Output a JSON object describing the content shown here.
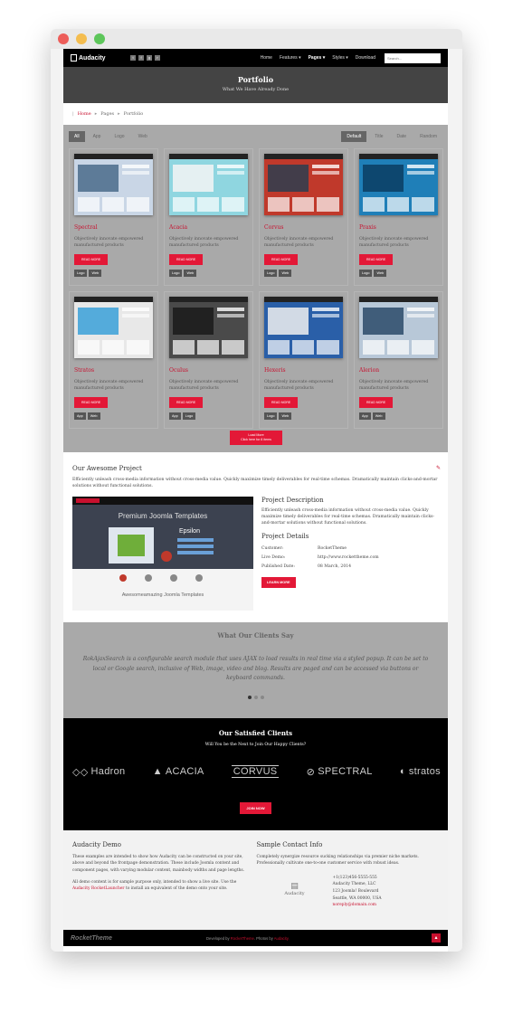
{
  "nav": {
    "logo": "Audacity",
    "social": [
      "t",
      "f",
      "g",
      "r"
    ],
    "menu": [
      "Home",
      "Features ▾",
      "Pages ▾",
      "Styles ▾",
      "Download"
    ],
    "search_placeholder": "Search..."
  },
  "hero": {
    "title": "Portfolio",
    "subtitle": "What We Have Already Done"
  },
  "breadcrumb": {
    "home": "Home",
    "pages": "Pages",
    "current": "Portfolio"
  },
  "filters": {
    "left": [
      "All",
      "App",
      "Logo",
      "Web"
    ],
    "right": [
      "Default",
      "Title",
      "Date",
      "Random"
    ]
  },
  "items": [
    {
      "title": "Spectral",
      "desc": "Objectively innovate empowered manufactured products",
      "btn": "READ MORE",
      "tags": [
        "Logo",
        "Web"
      ],
      "colors": [
        "#c9d6e6",
        "#4a6b8a"
      ]
    },
    {
      "title": "Acacia",
      "desc": "Objectively innovate empowered manufactured products",
      "btn": "READ MORE",
      "tags": [
        "Logo",
        "Web"
      ],
      "colors": [
        "#8fd6e0",
        "#f5f5f5"
      ]
    },
    {
      "title": "Corvus",
      "desc": "Objectively innovate empowered manufactured products",
      "btn": "READ MORE",
      "tags": [
        "Logo",
        "Web"
      ],
      "colors": [
        "#c0392b",
        "#2c3e50"
      ]
    },
    {
      "title": "Praxis",
      "desc": "Objectively innovate empowered manufactured products",
      "btn": "READ MORE",
      "tags": [
        "Logo",
        "Web"
      ],
      "colors": [
        "#1f7fb8",
        "#0b3d61"
      ]
    },
    {
      "title": "Stratos",
      "desc": "Objectively innovate empowered manufactured products",
      "btn": "READ MORE",
      "tags": [
        "App",
        "Web"
      ],
      "colors": [
        "#e8e8e8",
        "#3aa0d8"
      ]
    },
    {
      "title": "Oculus",
      "desc": "Objectively innovate empowered manufactured products",
      "btn": "READ MORE",
      "tags": [
        "App",
        "Logo"
      ],
      "colors": [
        "#4a4a4a",
        "#1a1a1a"
      ]
    },
    {
      "title": "Hexeris",
      "desc": "Objectively innovate empowered manufactured products",
      "btn": "READ MORE",
      "tags": [
        "Logo",
        "Web"
      ],
      "colors": [
        "#2a5fa8",
        "#f0f0f0"
      ]
    },
    {
      "title": "Alerion",
      "desc": "Objectively innovate empowered manufactured products",
      "btn": "READ MORE",
      "tags": [
        "App",
        "Web"
      ],
      "colors": [
        "#b8c8d8",
        "#2a4a6a"
      ]
    }
  ],
  "load_more": {
    "line1": "Load More",
    "line2": "Click here for 8 items"
  },
  "project": {
    "heading": "Our Awesome Project",
    "intro": "Efficiently unleash cross-media information without cross-media value. Quickly maximize timely deliverables for real-time schemas. Dramatically maintain clicks-and-mortar solutions without functional solutions.",
    "shot_title": "Premium Joomla Templates",
    "shot_sub": "Epsilon",
    "shot_caption": "Awesomeamazing Joomla Templates",
    "desc_heading": "Project Description",
    "desc": "Efficiently unleash cross-media information without cross-media value. Quickly maximize timely deliverables for real-time schemas. Dramatically maintain clicks-and-mortar solutions without functional solutions.",
    "details_heading": "Project Details",
    "details": [
      {
        "label": "Customer:",
        "value": "RocketTheme"
      },
      {
        "label": "Live Demo:",
        "value": "http://www.rockettheme.com"
      },
      {
        "label": "Published Date:",
        "value": "08 March, 2014"
      }
    ],
    "btn": "LEARN MORE"
  },
  "clients": {
    "heading": "What Our Clients Say",
    "quote": "RokAjaxSearch is a configurable search module that uses AJAX to load results in real time via a styled popup. It can be set to local or Google search, inclusive of Web, image, video and blog. Results are paged and can be accessed via buttons or keyboard commands."
  },
  "satisfied": {
    "heading": "Our Satisfied Clients",
    "sub": "Will You be the Next to Join Our Happy Clients?",
    "brands": [
      "Hadron",
      "ACACIA",
      "CORVUS",
      "SPECTRAL",
      "stratos"
    ],
    "btn": "JOIN NOW"
  },
  "footer": {
    "demo_heading": "Audacity Demo",
    "demo_p1": "These examples are intended to show how Audacity can be constructed on your site, above and beyond the frontpage demonstration. These include Joomla content and component pages, with varying modular content, mainbody widths and page lengths.",
    "demo_p2a": "All demo content is for sample purpose only, intended to show a live site. Use the",
    "demo_link": "Audacity RocketLauncher",
    "demo_p2b": "to install an equivalent of the demo onto your site.",
    "contact_heading": "Sample Contact Info",
    "contact_p": "Completely synergize resource sucking relationships via premier niche markets. Professionally cultivate one-to-one customer service with robust ideas.",
    "contact_logo": "Audacity",
    "phone": "+1(123)456-5555-555",
    "company": "Audacity Theme, LLC",
    "street": "123 Joomla! Boulevard",
    "city": "Seattle, WA 00000, USA",
    "email": "noreply@domain.com"
  },
  "bottom": {
    "brand": "RocketTheme",
    "credit_a": "Developed by",
    "credit_b": "RocketTheme",
    "credit_c": ". Photos by",
    "credit_d": "Audacity."
  }
}
